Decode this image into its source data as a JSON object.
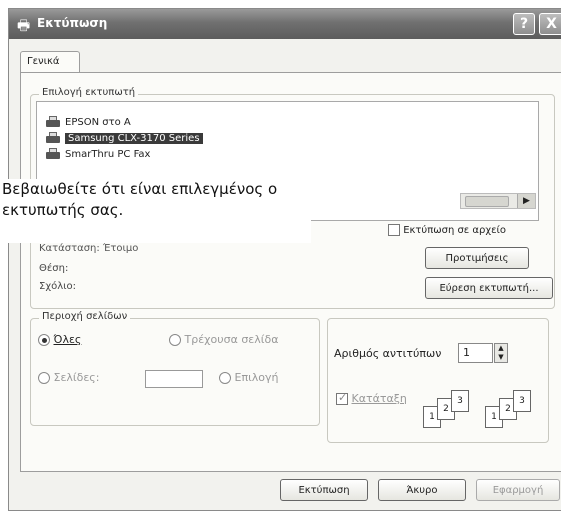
{
  "window": {
    "title": "Εκτύπωση",
    "help_button": "?",
    "close_button": "X"
  },
  "tabs": [
    {
      "label": "Γενικά"
    }
  ],
  "printer_select": {
    "legend": "Επιλογή εκτυπωτή",
    "printers": [
      {
        "name": "EPSON στο A",
        "selected": false
      },
      {
        "name": "Samsung CLX-3170 Series",
        "selected": true
      },
      {
        "name": "SmarThru PC Fax",
        "selected": false
      }
    ]
  },
  "callout": {
    "text": "Βεβαιωθείτε ότι είναι επιλεγμένος ο εκτυπωτής σας."
  },
  "info": {
    "status_label": "Κατάσταση:",
    "status_value": "Έτοιμο",
    "location_label": "Θέση:",
    "comment_label": "Σχόλιο:"
  },
  "print_to_file": {
    "label": "Εκτύπωση σε αρχείο",
    "checked": false
  },
  "buttons": {
    "preferences": "Προτιμήσεις",
    "find_printer": "Εύρεση εκτυπωτή...",
    "print": "Εκτύπωση",
    "cancel": "Άκυρο",
    "apply": "Εφαρμογή"
  },
  "page_range": {
    "legend": "Περιοχή σελίδων",
    "all": "Όλες",
    "current_page": "Τρέχουσα σελίδα",
    "pages": "Σελίδες:",
    "selection": "Επιλογή",
    "selected_option": "all"
  },
  "copies": {
    "label": "Αριθμός αντιτύπων",
    "value": "1",
    "collate_label": "Κατάταξη",
    "collate_checked": true,
    "page_numbers": [
      "1",
      "2",
      "3"
    ]
  },
  "scroll": {
    "arrow": "▶"
  }
}
